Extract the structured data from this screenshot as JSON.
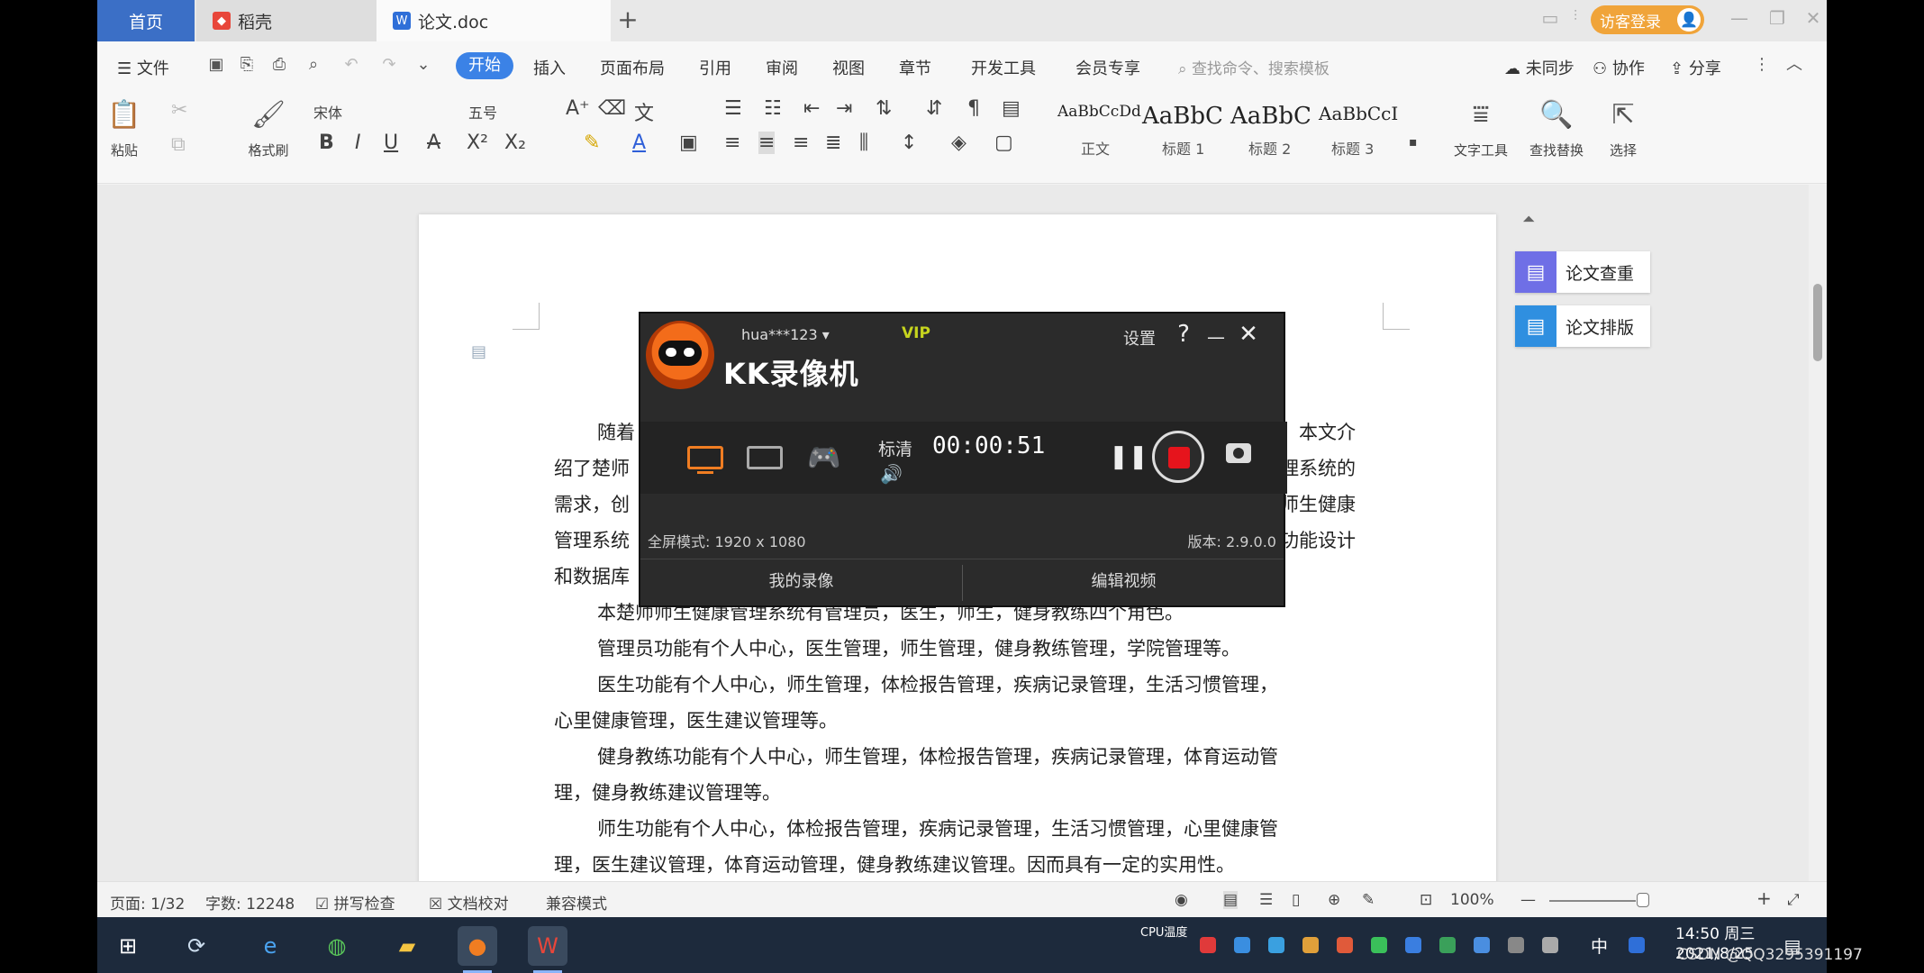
{
  "titlebar": {
    "home_tab": "首页",
    "straw_tab": "稻壳",
    "doc_tab": "论文.doc",
    "new_tab": "+",
    "login_pill": "访客登录"
  },
  "menubar": {
    "file": "文件",
    "items": [
      "开始",
      "插入",
      "页面布局",
      "引用",
      "审阅",
      "视图",
      "章节",
      "开发工具",
      "会员专享"
    ],
    "search_placeholder": "查找命令、搜索模板",
    "sync": "未同步",
    "collab": "协作",
    "share": "分享"
  },
  "ribbon": {
    "paste": "粘贴",
    "format_painter": "格式刷",
    "font_name": "宋体",
    "font_size": "五号",
    "styles": [
      {
        "sample": "AaBbCcDd",
        "name": "正文"
      },
      {
        "sample": "AaBbC",
        "name": "标题 1"
      },
      {
        "sample": "AaBbC",
        "name": "标题 2"
      },
      {
        "sample": "AaBbCcI",
        "name": "标题 3"
      }
    ],
    "text_tools": "文字工具",
    "find_replace": "查找替换",
    "select": "选择"
  },
  "document": {
    "paragraphs": [
      [
        "随着",
        "。本文介"
      ],
      [
        "绍了楚师",
        "理系统的"
      ],
      [
        "需求，创",
        "师生健康"
      ],
      [
        "管理系统",
        "功能设计"
      ],
      [
        "和数据库"
      ]
    ],
    "body": [
      {
        "indent": true,
        "text": "本楚师师生健康管理系统有管理员，医生，师生，健身教练四个角色。"
      },
      {
        "indent": true,
        "text": "管理员功能有个人中心，医生管理，师生管理，健身教练管理，学院管理等。"
      },
      {
        "indent": true,
        "text": "医生功能有个人中心，师生管理，体检报告管理，疾病记录管理，生活习惯管理，"
      },
      {
        "indent": false,
        "text": "心里健康管理，医生建议管理等。"
      },
      {
        "indent": true,
        "text": "健身教练功能有个人中心，师生管理，体检报告管理，疾病记录管理，体育运动管"
      },
      {
        "indent": false,
        "text": "理，健身教练建议管理等。"
      },
      {
        "indent": true,
        "text": "师生功能有个人中心，体检报告管理，疾病记录管理，生活习惯管理，心里健康管"
      },
      {
        "indent": false,
        "text": "理，医生建议管理，体育运动管理，健身教练建议管理。因而具有一定的实用性。"
      }
    ]
  },
  "side_panel": {
    "check": "论文查重",
    "layout": "论文排版"
  },
  "recorder": {
    "user": "hua***123",
    "vip": "VIP",
    "title": "KK录像机",
    "settings": "设置",
    "help": "?",
    "minimize": "—",
    "close": "✕",
    "quality": "标清",
    "timer": "00:00:51",
    "fullscreen_mode": "全屏模式: 1920 x 1080",
    "version": "版本: 2.9.0.0",
    "my_recordings": "我的录像",
    "edit_video": "编辑视频"
  },
  "statusbar": {
    "page": "页面: 1/32",
    "words": "字数: 12248",
    "spellcheck": "拼写检查",
    "doc_proof": "文档校对",
    "compat": "兼容模式",
    "zoom": "100%"
  },
  "taskbar": {
    "time": "14:50 周三",
    "date": "2021/8/25",
    "ime": "中",
    "tray_label": "CPU温度"
  },
  "watermark": "CSDN @QQ3295391197",
  "colors": {
    "accent_blue": "#3b82e6",
    "home_tab": "#3b6fc6",
    "login_orange": "#f0a43a",
    "recorder_bg": "#2b2b2b",
    "record_red": "#e6141c"
  }
}
